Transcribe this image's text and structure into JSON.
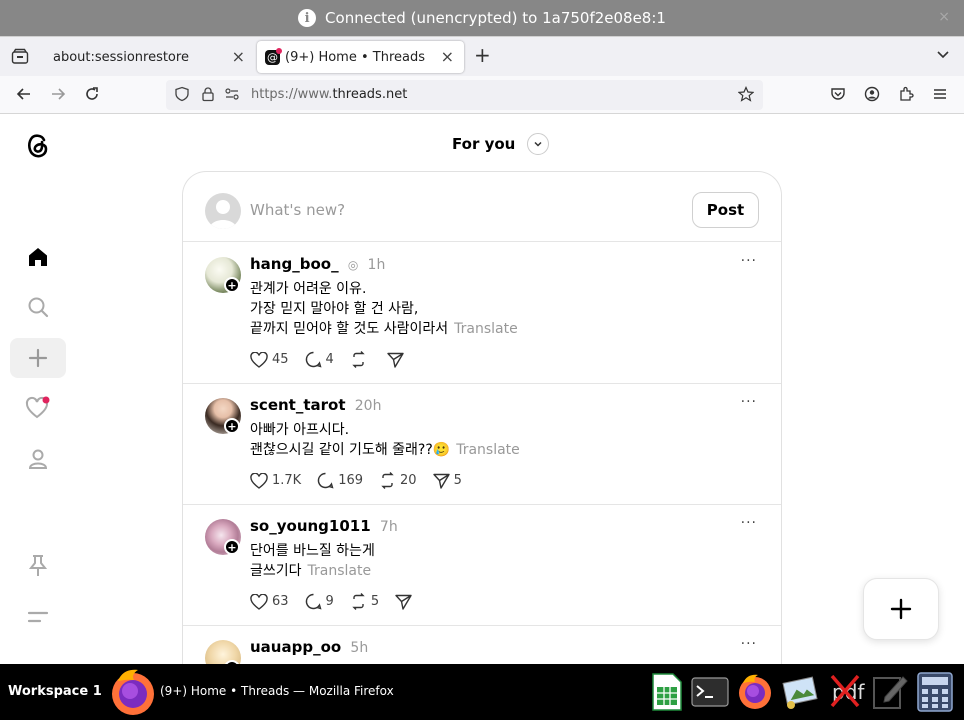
{
  "banner": {
    "text": "Connected (unencrypted) to 1a750f2e08e8:1",
    "info_icon": "i",
    "close": "×"
  },
  "tabs": [
    {
      "label": "about:sessionrestore",
      "close": "×"
    },
    {
      "label": "(9+) Home • Threads",
      "close": "×"
    }
  ],
  "newtab": "+",
  "url": {
    "prefix": "https://www.",
    "domain": "threads.net"
  },
  "feed": {
    "header": "For you",
    "composer_placeholder": "What's new?",
    "post_button": "Post",
    "posts": [
      {
        "user": "hang_boo_",
        "time": "1h",
        "lines": [
          "관계가 어려운 이유.",
          "가장 믿지 말아야 할 건 사람,",
          "끝까지 믿어야 할 것도 사람이라서"
        ],
        "translate": "Translate",
        "likes": "45",
        "replies": "4",
        "reposts": "",
        "shares": ""
      },
      {
        "user": "scent_tarot",
        "time": "20h",
        "lines": [
          "아빠가 아프시다.",
          "괜찮으시길 같이 기도해 줄래??🥲"
        ],
        "translate": "Translate",
        "likes": "1.7K",
        "replies": "169",
        "reposts": "20",
        "shares": "5"
      },
      {
        "user": "so_young1011",
        "time": "7h",
        "lines": [
          "단어를 바느질 하는게",
          "글쓰기다"
        ],
        "translate": "Translate",
        "likes": "63",
        "replies": "9",
        "reposts": "5",
        "shares": ""
      },
      {
        "user": "uauapp_oo",
        "time": "5h"
      }
    ],
    "more": "···"
  },
  "taskbar": {
    "workspace": "Workspace 1",
    "window_title": "(9+) Home • Threads — Mozilla Firefox",
    "pdf_label": "pdf"
  },
  "colors": {
    "banner": "#878787",
    "notification_dot": "#e0245e",
    "tab_strip": "#f0f0f4"
  }
}
